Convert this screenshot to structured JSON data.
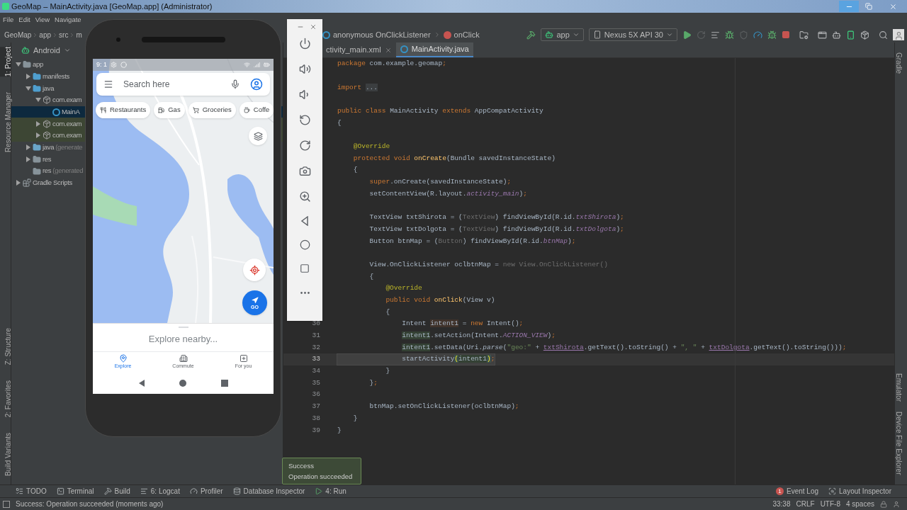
{
  "window": {
    "title": "GeoMap – MainActivity.java [GeoMap.app] (Administrator)"
  },
  "menu": [
    "File",
    "Edit",
    "View",
    "Navigate"
  ],
  "breadcrumb": {
    "left": [
      "GeoMap",
      "app",
      "src",
      "m"
    ],
    "right": [
      {
        "kind": "class",
        "label": "anonymous OnClickListener"
      },
      {
        "kind": "method",
        "label": "onClick"
      }
    ]
  },
  "run_config": {
    "module": "app",
    "device": "Nexus 5X API 30"
  },
  "side_tabs_left": [
    {
      "label": "1: Project",
      "kind": "top",
      "selected": true
    },
    {
      "label": "Resource Manager",
      "kind": "top",
      "selected": false
    },
    {
      "label": "Z: Structure",
      "kind": "bottom",
      "selected": false
    },
    {
      "label": "2: Favorites",
      "kind": "bottom",
      "selected": false
    },
    {
      "label": "Build Variants",
      "kind": "bottom",
      "selected": false
    }
  ],
  "side_tabs_right": [
    {
      "label": "Gradle",
      "kind": "top"
    },
    {
      "label": "Emulator",
      "kind": "bottom"
    },
    {
      "label": "Device File Explorer",
      "kind": "bottom"
    }
  ],
  "project": {
    "view": "Android",
    "tree": [
      {
        "label": "app",
        "kind": "module",
        "expanded": true,
        "selected": false,
        "children": [
          {
            "label": "manifests",
            "kind": "folder",
            "expanded": false,
            "selected": false
          },
          {
            "label": "java",
            "kind": "folder",
            "expanded": true,
            "selected": false,
            "children": [
              {
                "label": "com.exam",
                "kind": "package",
                "expanded": true,
                "selected": false,
                "children": [
                  {
                    "label": "MainA",
                    "kind": "class",
                    "selected": true
                  }
                ]
              },
              {
                "label": "com.exam",
                "kind": "test-package",
                "expanded": false,
                "selected": false
              },
              {
                "label": "com.exam",
                "kind": "test-package",
                "expanded": false,
                "selected": false
              }
            ]
          },
          {
            "label": "java",
            "note": "(generate",
            "kind": "generated",
            "expanded": false,
            "selected": false
          },
          {
            "label": "res",
            "kind": "res",
            "expanded": false,
            "selected": false
          },
          {
            "label": "res",
            "note": "(generated",
            "kind": "res",
            "selected": false
          }
        ]
      },
      {
        "label": "Gradle Scripts",
        "kind": "gradle",
        "expanded": false,
        "selected": false
      }
    ]
  },
  "editor_tabs": [
    {
      "label": "ctivity_main.xml",
      "kind": "xml",
      "closable": true,
      "selected": false
    },
    {
      "label": "MainActivity.java",
      "kind": "java",
      "closable": false,
      "selected": true
    }
  ],
  "code": [
    {
      "kind": "code",
      "current": false,
      "segs": [
        {
          "kind": "kw",
          "text": "package "
        },
        {
          "kind": "plain",
          "text": "com.example.geomap"
        },
        {
          "kind": "kw",
          "text": ";"
        }
      ]
    },
    {
      "kind": "blank"
    },
    {
      "kind": "code",
      "current": false,
      "segs": [
        {
          "kind": "kw",
          "text": "import "
        },
        {
          "kind": "fold",
          "text": "..."
        }
      ]
    },
    {
      "kind": "blank"
    },
    {
      "kind": "code",
      "current": false,
      "segs": [
        {
          "kind": "kw",
          "text": "public class "
        },
        {
          "kind": "plain",
          "text": "MainActivity "
        },
        {
          "kind": "kw",
          "text": "extends "
        },
        {
          "kind": "plain",
          "text": "AppCompatActivity"
        }
      ]
    },
    {
      "kind": "code",
      "current": false,
      "segs": [
        {
          "kind": "plain",
          "text": "{"
        }
      ]
    },
    {
      "kind": "blank"
    },
    {
      "kind": "code",
      "current": false,
      "segs": [
        {
          "kind": "ann",
          "text": "    @Override"
        }
      ]
    },
    {
      "kind": "code",
      "current": false,
      "segs": [
        {
          "kind": "kw",
          "text": "    protected void "
        },
        {
          "kind": "fn",
          "text": "onCreate"
        },
        {
          "kind": "plain",
          "text": "(Bundle savedInstanceState)"
        }
      ]
    },
    {
      "kind": "code",
      "current": false,
      "segs": [
        {
          "kind": "plain",
          "text": "    {"
        }
      ]
    },
    {
      "kind": "code",
      "current": false,
      "segs": [
        {
          "kind": "kw",
          "text": "        super"
        },
        {
          "kind": "plain",
          "text": ".onCreate(savedInstanceState)"
        },
        {
          "kind": "kw",
          "text": ";"
        }
      ]
    },
    {
      "kind": "code",
      "current": false,
      "segs": [
        {
          "kind": "plain",
          "text": "        setContentView(R.layout."
        },
        {
          "kind": "field",
          "text": "activity_main"
        },
        {
          "kind": "plain",
          "text": ")"
        },
        {
          "kind": "kw",
          "text": ";"
        }
      ]
    },
    {
      "kind": "blank"
    },
    {
      "kind": "code",
      "current": false,
      "segs": [
        {
          "kind": "plain",
          "text": "        TextView txtShirota = ("
        },
        {
          "kind": "dim",
          "text": "TextView"
        },
        {
          "kind": "plain",
          "text": ") findViewById(R.id."
        },
        {
          "kind": "field",
          "text": "txtShirota"
        },
        {
          "kind": "plain",
          "text": ")"
        },
        {
          "kind": "kw",
          "text": ";"
        }
      ]
    },
    {
      "kind": "code",
      "current": false,
      "segs": [
        {
          "kind": "plain",
          "text": "        TextView txtDolgota = ("
        },
        {
          "kind": "dim",
          "text": "TextView"
        },
        {
          "kind": "plain",
          "text": ") findViewById(R.id."
        },
        {
          "kind": "field",
          "text": "txtDolgota"
        },
        {
          "kind": "plain",
          "text": ")"
        },
        {
          "kind": "kw",
          "text": ";"
        }
      ]
    },
    {
      "kind": "code",
      "current": false,
      "segs": [
        {
          "kind": "plain",
          "text": "        Button btnMap = ("
        },
        {
          "kind": "dim",
          "text": "Button"
        },
        {
          "kind": "plain",
          "text": ") findViewById(R.id."
        },
        {
          "kind": "field",
          "text": "btnMap"
        },
        {
          "kind": "plain",
          "text": ")"
        },
        {
          "kind": "kw",
          "text": ";"
        }
      ]
    },
    {
      "kind": "blank"
    },
    {
      "kind": "code",
      "current": false,
      "segs": [
        {
          "kind": "plain",
          "text": "        View.OnClickListener oclbtnMap = "
        },
        {
          "kind": "dim",
          "text": "new View.OnClickListener()"
        }
      ]
    },
    {
      "kind": "code",
      "current": false,
      "segs": [
        {
          "kind": "plain",
          "text": "        {"
        }
      ]
    },
    {
      "kind": "code",
      "current": false,
      "segs": [
        {
          "kind": "ann",
          "text": "            @Override"
        }
      ]
    },
    {
      "kind": "code",
      "current": false,
      "segs": [
        {
          "kind": "kw",
          "text": "            public void "
        },
        {
          "kind": "fn",
          "text": "onClick"
        },
        {
          "kind": "plain",
          "text": "(View v)"
        }
      ]
    },
    {
      "kind": "code",
      "current": false,
      "segs": [
        {
          "kind": "plain",
          "text": "            {"
        }
      ]
    },
    {
      "kind": "code",
      "num": "30",
      "current": false,
      "segs": [
        {
          "kind": "plain",
          "text": "                Intent "
        },
        {
          "kind": "decl",
          "text": "intent1"
        },
        {
          "kind": "plain",
          "text": " = "
        },
        {
          "kind": "kw",
          "text": "new "
        },
        {
          "kind": "plain",
          "text": "Intent()"
        },
        {
          "kind": "kw",
          "text": ";"
        }
      ]
    },
    {
      "kind": "code",
      "num": "31",
      "current": false,
      "segs": [
        {
          "kind": "usage",
          "text": "                intent1"
        },
        {
          "kind": "plain",
          "text": ".setAction(Intent."
        },
        {
          "kind": "field",
          "text": "ACTION_VIEW"
        },
        {
          "kind": "plain",
          "text": ")"
        },
        {
          "kind": "kw",
          "text": ";"
        }
      ]
    },
    {
      "kind": "code",
      "num": "32",
      "current": false,
      "segs": [
        {
          "kind": "usage",
          "text": "                intent1"
        },
        {
          "kind": "plain",
          "text": ".setData(Uri."
        },
        {
          "kind": "italic",
          "text": "parse"
        },
        {
          "kind": "plain",
          "text": "("
        },
        {
          "kind": "str",
          "text": "\"geo:\""
        },
        {
          "kind": "plain",
          "text": " + "
        },
        {
          "kind": "ulink",
          "text": "txtShirota"
        },
        {
          "kind": "plain",
          "text": ".getText().toString() + "
        },
        {
          "kind": "str",
          "text": "\", \""
        },
        {
          "kind": "plain",
          "text": " + "
        },
        {
          "kind": "ulink",
          "text": "txtDolgota"
        },
        {
          "kind": "plain",
          "text": ".getText().toString()))"
        },
        {
          "kind": "kw",
          "text": ";"
        }
      ]
    },
    {
      "kind": "code",
      "num": "33",
      "current": true,
      "segs": [
        {
          "kind": "plain",
          "text": "                startActivity"
        },
        {
          "kind": "match",
          "text": "("
        },
        {
          "kind": "usage",
          "text": "intent1"
        },
        {
          "kind": "match",
          "text": ")"
        },
        {
          "kind": "kw",
          "text": ";"
        }
      ]
    },
    {
      "kind": "code",
      "num": "34",
      "current": false,
      "segs": [
        {
          "kind": "plain",
          "text": "            }"
        }
      ]
    },
    {
      "kind": "code",
      "num": "35",
      "current": false,
      "segs": [
        {
          "kind": "plain",
          "text": "        }"
        },
        {
          "kind": "kw",
          "text": ";"
        }
      ]
    },
    {
      "kind": "blank",
      "num": "36"
    },
    {
      "kind": "code",
      "num": "37",
      "current": false,
      "segs": [
        {
          "kind": "plain",
          "text": "        btnMap.setOnClickListener(oclbtnMap)"
        },
        {
          "kind": "kw",
          "text": ";"
        }
      ]
    },
    {
      "kind": "code",
      "num": "38",
      "current": false,
      "segs": [
        {
          "kind": "plain",
          "text": "    }"
        }
      ]
    },
    {
      "kind": "code",
      "num": "39",
      "current": false,
      "segs": [
        {
          "kind": "plain",
          "text": "}"
        }
      ]
    }
  ],
  "phone": {
    "status_time": "9: 1",
    "search_placeholder": "Search here",
    "chips": [
      {
        "kind": "restaurant",
        "label": "Restaurants"
      },
      {
        "kind": "gas",
        "label": "Gas"
      },
      {
        "kind": "grocery",
        "label": "Groceries"
      },
      {
        "kind": "coffee",
        "label": "Coffe"
      }
    ],
    "go_label": "GO",
    "sheet_title": "Explore nearby...",
    "nav": [
      {
        "kind": "explore",
        "label": "Explore",
        "selected": true
      },
      {
        "kind": "commute",
        "label": "Commute",
        "selected": false
      },
      {
        "kind": "foryou",
        "label": "For you",
        "selected": false
      }
    ]
  },
  "toast": {
    "title": "Success",
    "message": "Operation succeeded"
  },
  "tool_windows": [
    {
      "kind": "todo",
      "label": "TODO"
    },
    {
      "kind": "terminal",
      "label": "Terminal"
    },
    {
      "kind": "build",
      "label": "Build"
    },
    {
      "kind": "logcat",
      "label": "6: Logcat"
    },
    {
      "kind": "profiler",
      "label": "Profiler"
    },
    {
      "kind": "database",
      "label": "Database Inspector"
    },
    {
      "kind": "run",
      "label": "4: Run"
    }
  ],
  "tool_windows_right": [
    {
      "kind": "event-log",
      "label": "Event Log",
      "badge": "1"
    },
    {
      "kind": "layout-inspector",
      "label": "Layout Inspector"
    }
  ],
  "status": {
    "message": "Success: Operation succeeded (moments ago)",
    "position": "33:38",
    "line_sep": "CRLF",
    "encoding": "UTF-8",
    "indent": "4 spaces"
  }
}
